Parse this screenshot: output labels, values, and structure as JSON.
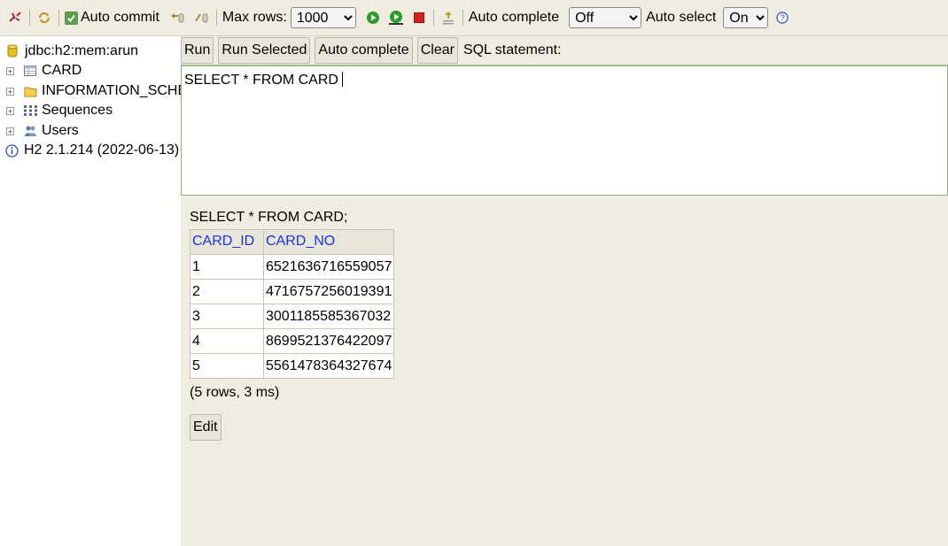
{
  "toolbar": {
    "auto_commit_label": "Auto commit",
    "max_rows_label": "Max rows:",
    "max_rows_value": "1000",
    "auto_complete_label": "Auto complete",
    "auto_complete_value": "Off",
    "auto_select_label": "Auto select",
    "auto_select_value": "On",
    "help_glyph": "?"
  },
  "sidebar": {
    "connection": "jdbc:h2:mem:arun",
    "items": [
      {
        "label": "CARD",
        "icon": "table-icon"
      },
      {
        "label": "INFORMATION_SCHEMA",
        "icon": "folder-icon"
      },
      {
        "label": "Sequences",
        "icon": "sequences-icon"
      },
      {
        "label": "Users",
        "icon": "users-icon"
      }
    ],
    "version": "H2 2.1.214 (2022-06-13)"
  },
  "buttons": {
    "run": "Run",
    "run_selected": "Run Selected",
    "auto_complete": "Auto complete",
    "clear": "Clear",
    "sql_label": "SQL statement:",
    "edit": "Edit"
  },
  "editor": {
    "text": "SELECT * FROM CARD"
  },
  "result": {
    "query": "SELECT * FROM CARD;",
    "columns": [
      "CARD_ID",
      "CARD_NO"
    ],
    "rows": [
      [
        "1",
        "6521636716559057"
      ],
      [
        "2",
        "4716757256019391"
      ],
      [
        "3",
        "3001185585367032"
      ],
      [
        "4",
        "8699521376422097"
      ],
      [
        "5",
        "5561478364327674"
      ]
    ],
    "summary": "(5 rows, 3 ms)"
  },
  "colors": {
    "panel": "#f0ede0",
    "link": "#1a33e8",
    "run_green": "#2e9a2e",
    "stop_red": "#d42020"
  }
}
